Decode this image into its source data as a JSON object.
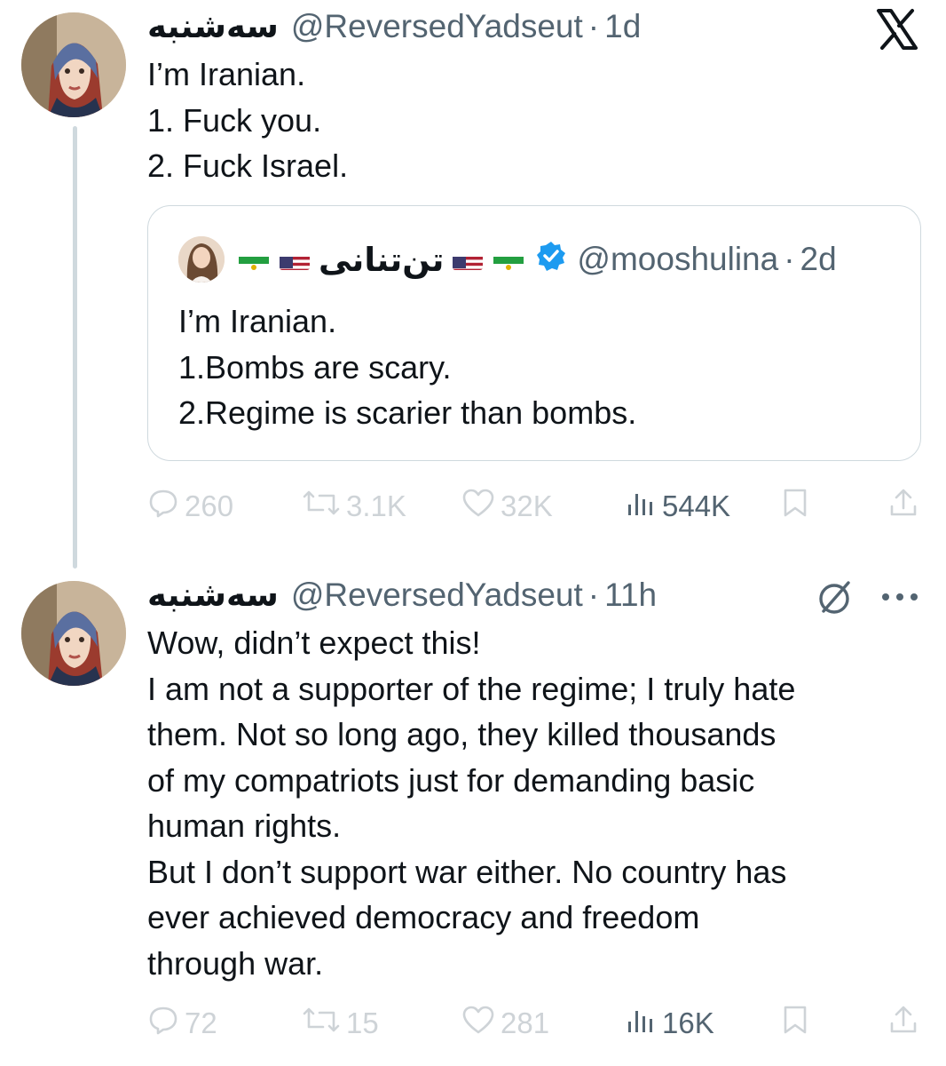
{
  "brand": {
    "logo": "X"
  },
  "tweet1": {
    "name": "سه‌شنبه",
    "handle": "@ReversedYadseut",
    "time": "1d",
    "lines": [
      "I’m Iranian.",
      "1. Fuck you.",
      "2. Fuck Israel."
    ],
    "stats": {
      "replies": "260",
      "reposts": "3.1K",
      "likes": "32K",
      "views": "544K"
    }
  },
  "quote": {
    "name": "تن‌تنانی",
    "handle": "@mooshulina",
    "time": "2d",
    "lines": [
      "I’m Iranian.",
      "1.Bombs are scary.",
      "2.Regime is scarier than bombs."
    ]
  },
  "tweet2": {
    "name": "سه‌شنبه",
    "handle": "@ReversedYadseut",
    "time": "11h",
    "lines": [
      "Wow, didn’t expect this!",
      "I am not a supporter of the regime; I truly hate",
      "them. Not so long ago, they killed thousands",
      "of my compatriots just for demanding basic",
      "human rights.",
      "But I don’t support war either. No country has",
      "ever achieved democracy and freedom",
      "through war."
    ],
    "stats": {
      "replies": "72",
      "reposts": "15",
      "likes": "281",
      "views": "16K"
    }
  },
  "colors": {
    "text": "#0f1419",
    "secondary": "#536471",
    "border": "#cfd9de",
    "verified": "#1d9bf0"
  },
  "icons": [
    "x-logo-icon",
    "reply-icon",
    "repost-icon",
    "like-icon",
    "views-icon",
    "bookmark-icon",
    "share-icon",
    "grok-icon",
    "more-icon",
    "verified-badge-icon"
  ]
}
